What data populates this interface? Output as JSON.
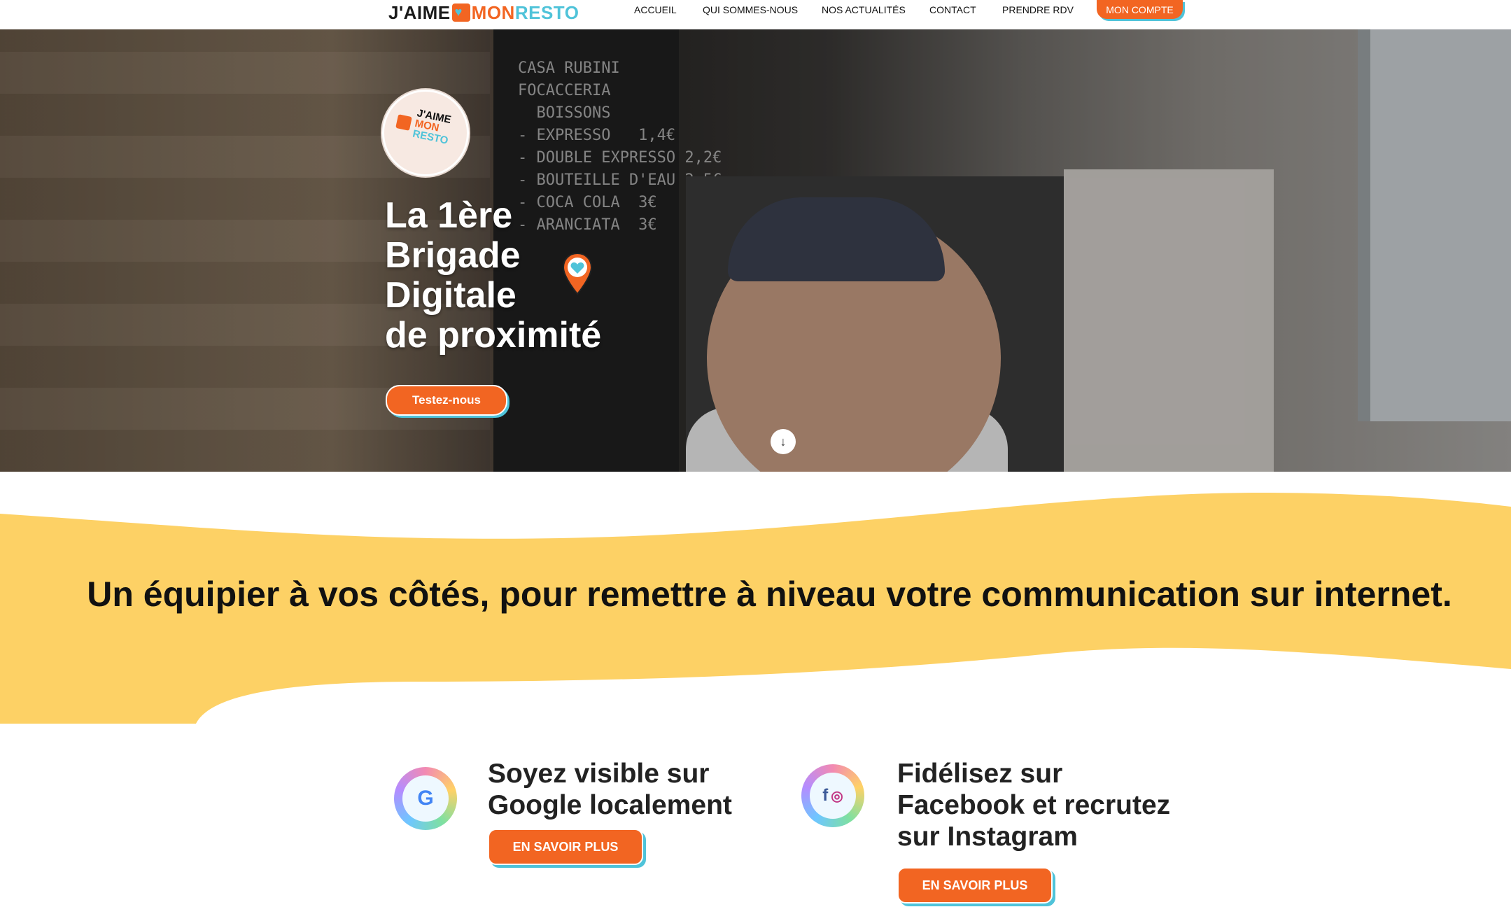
{
  "header": {
    "logo": {
      "part1": "J'AIME",
      "part2": "MON",
      "part3": "RESTO"
    },
    "nav": [
      {
        "label": "ACCUEIL"
      },
      {
        "label": "QUI SOMMES-NOUS"
      },
      {
        "label": "NOS ACTUALITÉS"
      },
      {
        "label": "CONTACT"
      },
      {
        "label": "PRENDRE RDV"
      }
    ],
    "account_button": "MON COMPTE"
  },
  "hero": {
    "badge": {
      "line1": "J'AIME",
      "line2": "MON",
      "line3": "RESTO"
    },
    "title_lines": [
      "La 1ère",
      "Brigade",
      "Digitale",
      "de proximité"
    ],
    "board_text": "CASA RUBINI\nFOCACCERIA\n  BOISSONS\n- EXPRESSO   1,4€\n- DOUBLE EXPRESSO 2,2€\n- BOUTEILLE D'EAU 2,5€\n- COCA COLA  3€\n- ARANCIATA  3€",
    "cta": "Testez-nous"
  },
  "tagline": "Un équipier à vos côtés, pour remettre à niveau votre communication sur internet.",
  "features": [
    {
      "title_lines": [
        "Soyez visible sur",
        "Google localement"
      ],
      "icon": "google-icon",
      "button": "EN SAVOIR PLUS"
    },
    {
      "title_lines": [
        "Fidélisez sur",
        "Facebook et recrutez",
        "sur Instagram"
      ],
      "icon": "facebook-instagram-icon",
      "button": "EN SAVOIR PLUS"
    }
  ],
  "colors": {
    "accent_orange": "#f26522",
    "accent_teal": "#4fc3d9",
    "wave_yellow": "#fdd165"
  }
}
